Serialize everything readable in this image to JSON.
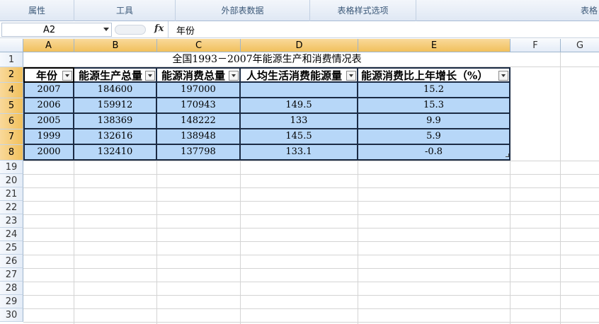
{
  "ribbon": {
    "groups": [
      {
        "label": "属性"
      },
      {
        "label": "工具"
      },
      {
        "label": "外部表数据"
      },
      {
        "label": "表格样式选项"
      },
      {
        "label": "表格"
      }
    ]
  },
  "formula_bar": {
    "cell_ref": "A2",
    "fx_label": "fx",
    "content": "年份"
  },
  "columns": [
    "A",
    "B",
    "C",
    "D",
    "E",
    "F",
    "G"
  ],
  "rows": [
    "1",
    "2",
    "4",
    "5",
    "6",
    "7",
    "8",
    "19",
    "20",
    "21",
    "22",
    "23",
    "24",
    "25",
    "26",
    "27",
    "28",
    "29",
    "30"
  ],
  "sheet": {
    "title": "全国1993－2007年能源生产和消费情况表",
    "headers": [
      "年份",
      "能源生产总量",
      "能源消费总量",
      "人均生活消费能源量",
      "能源消费比上年增长（%）"
    ],
    "data": [
      [
        "2007",
        "184600",
        "197000",
        "",
        "15.2"
      ],
      [
        "2006",
        "159912",
        "170943",
        "149.5",
        "15.3"
      ],
      [
        "2005",
        "138369",
        "148222",
        "133",
        "9.9"
      ],
      [
        "1999",
        "132616",
        "138948",
        "145.5",
        "5.9"
      ],
      [
        "2000",
        "132410",
        "137798",
        "133.1",
        "-0.8"
      ]
    ]
  },
  "colors": {
    "table_fill": "#b7d7f8",
    "selected_header": "#f1c05c"
  }
}
